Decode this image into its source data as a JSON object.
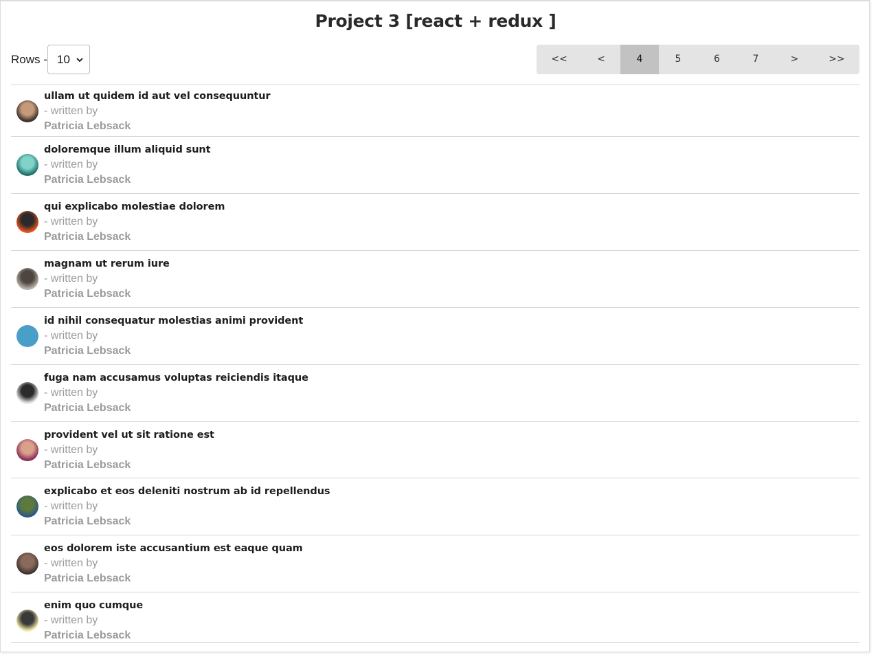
{
  "header": {
    "title": "Project 3 [react + redux ]"
  },
  "rows_control": {
    "label": "Rows -",
    "selected": "10"
  },
  "pagination": {
    "buttons": [
      "<<",
      "<",
      "4",
      "5",
      "6",
      "7",
      ">",
      ">>"
    ],
    "active": "4"
  },
  "posts": [
    {
      "title": "ullam ut quidem id aut vel consequuntur",
      "written_by": "- written by",
      "author": "Patricia Lebsack",
      "avatar_colors": [
        "#3a2f2a",
        "#c49a7a"
      ]
    },
    {
      "title": "doloremque illum aliquid sunt",
      "written_by": "- written by",
      "author": "Patricia Lebsack",
      "avatar_colors": [
        "#1f6f6a",
        "#7fd3c7"
      ]
    },
    {
      "title": "qui explicabo molestiae dolorem",
      "written_by": "- written by",
      "author": "Patricia Lebsack",
      "avatar_colors": [
        "#e8531f",
        "#2a2a2a"
      ]
    },
    {
      "title": "magnam ut rerum iure",
      "written_by": "- written by",
      "author": "Patricia Lebsack",
      "avatar_colors": [
        "#b8b2aa",
        "#4d4640"
      ]
    },
    {
      "title": "id nihil consequatur molestias animi provident",
      "written_by": "- written by",
      "author": "Patricia Lebsack",
      "avatar_colors": [
        "#4a9fc9",
        "#4a9fc9"
      ]
    },
    {
      "title": "fuga nam accusamus voluptas reiciendis itaque",
      "written_by": "- written by",
      "author": "Patricia Lebsack",
      "avatar_colors": [
        "#e6e6e6",
        "#2b2b2b"
      ]
    },
    {
      "title": "provident vel ut sit ratione est",
      "written_by": "- written by",
      "author": "Patricia Lebsack",
      "avatar_colors": [
        "#8a2d5a",
        "#d9a08a"
      ]
    },
    {
      "title": "explicabo et eos deleniti nostrum ab id repellendus",
      "written_by": "- written by",
      "author": "Patricia Lebsack",
      "avatar_colors": [
        "#2c5a86",
        "#5d7a3c"
      ]
    },
    {
      "title": "eos dolorem iste accusantium est eaque quam",
      "written_by": "- written by",
      "author": "Patricia Lebsack",
      "avatar_colors": [
        "#3e3532",
        "#8a6a5a"
      ]
    },
    {
      "title": "enim quo cumque",
      "written_by": "- written by",
      "author": "Patricia Lebsack",
      "avatar_colors": [
        "#f4e9a8",
        "#3a3a3a"
      ]
    }
  ]
}
